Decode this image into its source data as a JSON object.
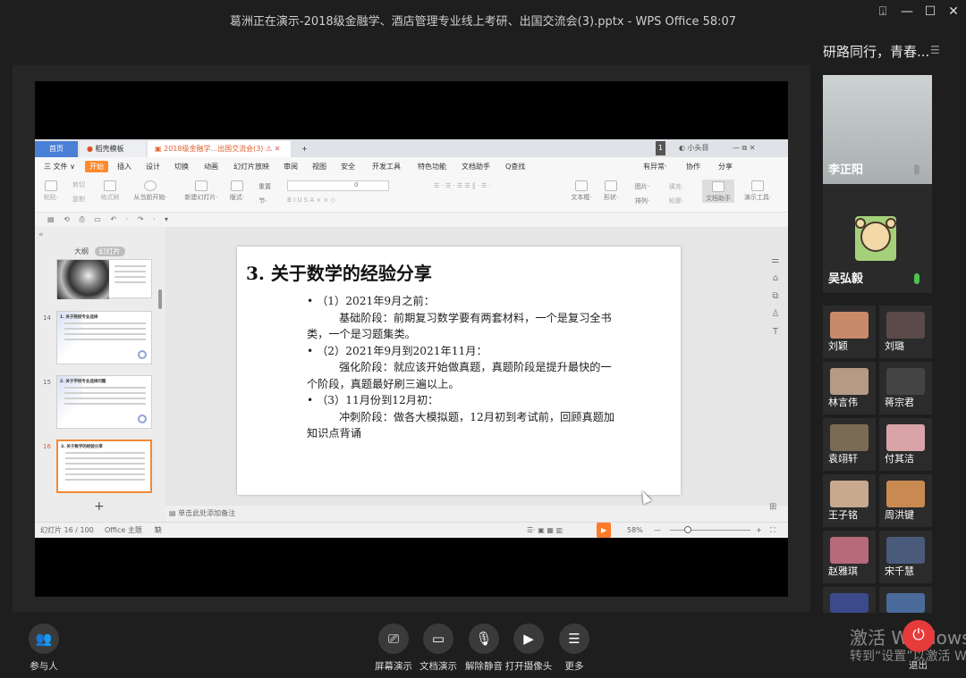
{
  "window": {
    "title": "葛洲正在演示-2018级金融学、酒店管理专业线上考研、出国交流会(3).pptx - WPS Office 58:07",
    "controls": [
      "⍗",
      "—",
      "☐",
      "✕"
    ]
  },
  "wps": {
    "tabs": {
      "home": "首页",
      "template": "稻壳模板",
      "doc": "2018级金融学...出国交流会(3)",
      "add": "+"
    },
    "tab_right": {
      "page_badge": "1",
      "user": "小头目"
    },
    "menu": [
      "三 文件 ∨",
      "开始",
      "插入",
      "设计",
      "切换",
      "动画",
      "幻灯片放映",
      "审阅",
      "视图",
      "安全",
      "开发工具",
      "特色功能",
      "文档助手",
      "Q查找"
    ],
    "menu_right": [
      "有异常·",
      "协作",
      "分享"
    ],
    "ribbon": [
      "粘贴·",
      "剪切",
      "复制",
      "格式刷",
      "从当前开始·",
      "新建幻灯片·",
      "版式·",
      "节·",
      "重置",
      "文本框·",
      "形状·",
      "图片·",
      "排列·",
      "填充·",
      "轮廓·",
      "文档助手",
      "演示工具·"
    ],
    "font_size": "0",
    "panel": {
      "tab_outline": "大纲",
      "tab_slides": "幻灯片",
      "thumbs": [
        {
          "num": "",
          "title": ""
        },
        {
          "num": "14",
          "title": "1. 关于院校专业选择"
        },
        {
          "num": "15",
          "title": "2. 关于学校专业选择问题"
        },
        {
          "num": "16",
          "title": "3. 关于数学的经验分享"
        }
      ],
      "add": "+"
    },
    "slide": {
      "title": "3.  关于数学的经验分享",
      "lines": [
        {
          "type": "bullet",
          "text": "（1）2021年9月之前："
        },
        {
          "type": "para",
          "text": "基础阶段：前期复习数学要有两套材料，一个是复习全书类，一个是习题集类。"
        },
        {
          "type": "bullet",
          "text": "（2）2021年9月到2021年11月："
        },
        {
          "type": "para",
          "text": "强化阶段：就应该开始做真题，真题阶段是提升最快的一个阶段，真题最好刷三遍以上。"
        },
        {
          "type": "bullet",
          "text": "（3）11月份到12月初："
        },
        {
          "type": "para",
          "text": "冲刺阶段：做各大模拟题，12月初到考试前，回顾真题加知识点背诵"
        }
      ]
    },
    "note_placeholder": "单击此处添加备注",
    "status": {
      "slide_count": "幻灯片 16 / 100",
      "theme": "Office 主题",
      "missing_font": "缺失字体",
      "zoom": "58%"
    }
  },
  "right_panel": {
    "title": "研路同行，青春...",
    "big_tiles": [
      {
        "name": "李正阳"
      },
      {
        "name": "吴弘毅"
      }
    ],
    "small_tiles": [
      {
        "name": "刘颖",
        "color": "#c98a6a"
      },
      {
        "name": "刘璐",
        "color": "#5a4a4a"
      },
      {
        "name": "林言伟",
        "color": "#b79a86"
      },
      {
        "name": "蒋宗君",
        "color": "#444"
      },
      {
        "name": "袁翊轩",
        "color": "#7a6b55"
      },
      {
        "name": "付其洁",
        "color": "#d9a3a8"
      },
      {
        "name": "王子铭",
        "color": "#c9a98e"
      },
      {
        "name": "周洪键",
        "color": "#c98a52"
      },
      {
        "name": "赵雅琪",
        "color": "#b76a7a"
      },
      {
        "name": "宋千慧",
        "color": "#4a5a7a"
      }
    ]
  },
  "bottom_bar": {
    "participants": "参与人",
    "screen_share": "屏幕演示",
    "doc_share": "文档演示",
    "unmute": "解除静音",
    "camera": "打开摄像头",
    "more": "更多",
    "exit": "退出"
  },
  "watermark": {
    "line1": "激活 Windows",
    "line2": "转到“设置”以激活 W"
  }
}
